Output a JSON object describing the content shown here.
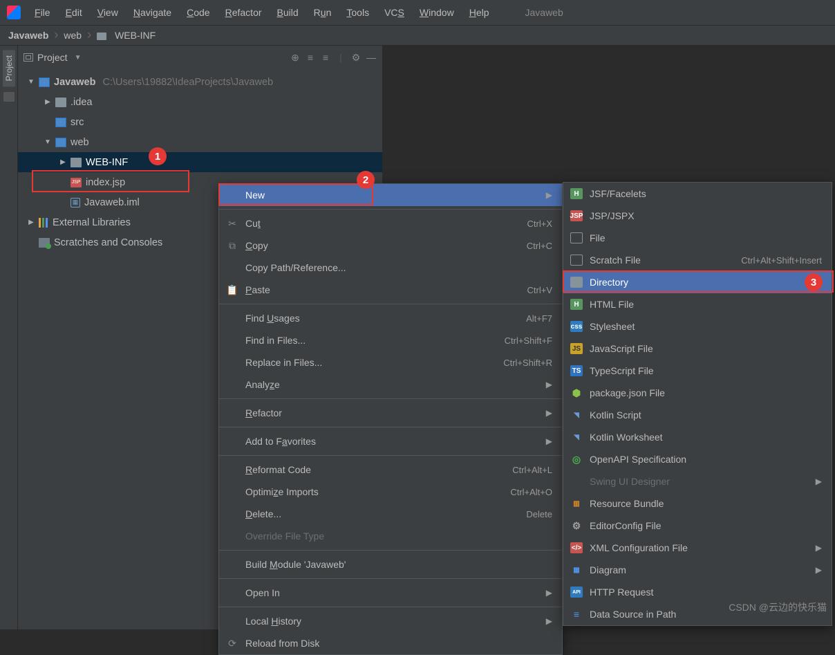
{
  "menubar": {
    "items": [
      "File",
      "Edit",
      "View",
      "Navigate",
      "Code",
      "Refactor",
      "Build",
      "Run",
      "Tools",
      "VCS",
      "Window",
      "Help"
    ],
    "app_title": "Javaweb"
  },
  "breadcrumb": {
    "root": "Javaweb",
    "mid": "web",
    "last": "WEB-INF"
  },
  "panel": {
    "title": "Project",
    "tab_label": "Project"
  },
  "tree": {
    "root_name": "Javaweb",
    "root_path": "C:\\Users\\19882\\IdeaProjects\\Javaweb",
    "idea": ".idea",
    "src": "src",
    "web": "web",
    "webinf": "WEB-INF",
    "index": "index.jsp",
    "iml": "Javaweb.iml",
    "ext": "External Libraries",
    "scratches": "Scratches and Consoles"
  },
  "badges": {
    "b1": "1",
    "b2": "2",
    "b3": "3"
  },
  "ctx1": {
    "new": "New",
    "cut": "Cut",
    "cut_s": "Ctrl+X",
    "copy": "Copy",
    "copy_s": "Ctrl+C",
    "cpr": "Copy Path/Reference...",
    "paste": "Paste",
    "paste_s": "Ctrl+V",
    "fu": "Find Usages",
    "fu_s": "Alt+F7",
    "fif": "Find in Files...",
    "fif_s": "Ctrl+Shift+F",
    "rif": "Replace in Files...",
    "rif_s": "Ctrl+Shift+R",
    "analyze": "Analyze",
    "refactor": "Refactor",
    "fav": "Add to Favorites",
    "reformat": "Reformat Code",
    "reformat_s": "Ctrl+Alt+L",
    "oi": "Optimize Imports",
    "oi_s": "Ctrl+Alt+O",
    "del": "Delete...",
    "del_s": "Delete",
    "override": "Override File Type",
    "bm": "Build Module 'Javaweb'",
    "openin": "Open In",
    "lh": "Local History",
    "reload": "Reload from Disk"
  },
  "ctx2": {
    "jsf": "JSF/Facelets",
    "jsp": "JSP/JSPX",
    "file": "File",
    "scratch": "Scratch File",
    "scratch_s": "Ctrl+Alt+Shift+Insert",
    "dir": "Directory",
    "html": "HTML File",
    "css": "Stylesheet",
    "js": "JavaScript File",
    "ts": "TypeScript File",
    "pkg": "package.json File",
    "ks": "Kotlin Script",
    "kw": "Kotlin Worksheet",
    "api": "OpenAPI Specification",
    "swing": "Swing UI Designer",
    "rb": "Resource Bundle",
    "ec": "EditorConfig File",
    "xml": "XML Configuration File",
    "dia": "Diagram",
    "http": "HTTP Request",
    "ds": "Data Source in Path"
  },
  "watermark": "CSDN @云边的快乐猫"
}
